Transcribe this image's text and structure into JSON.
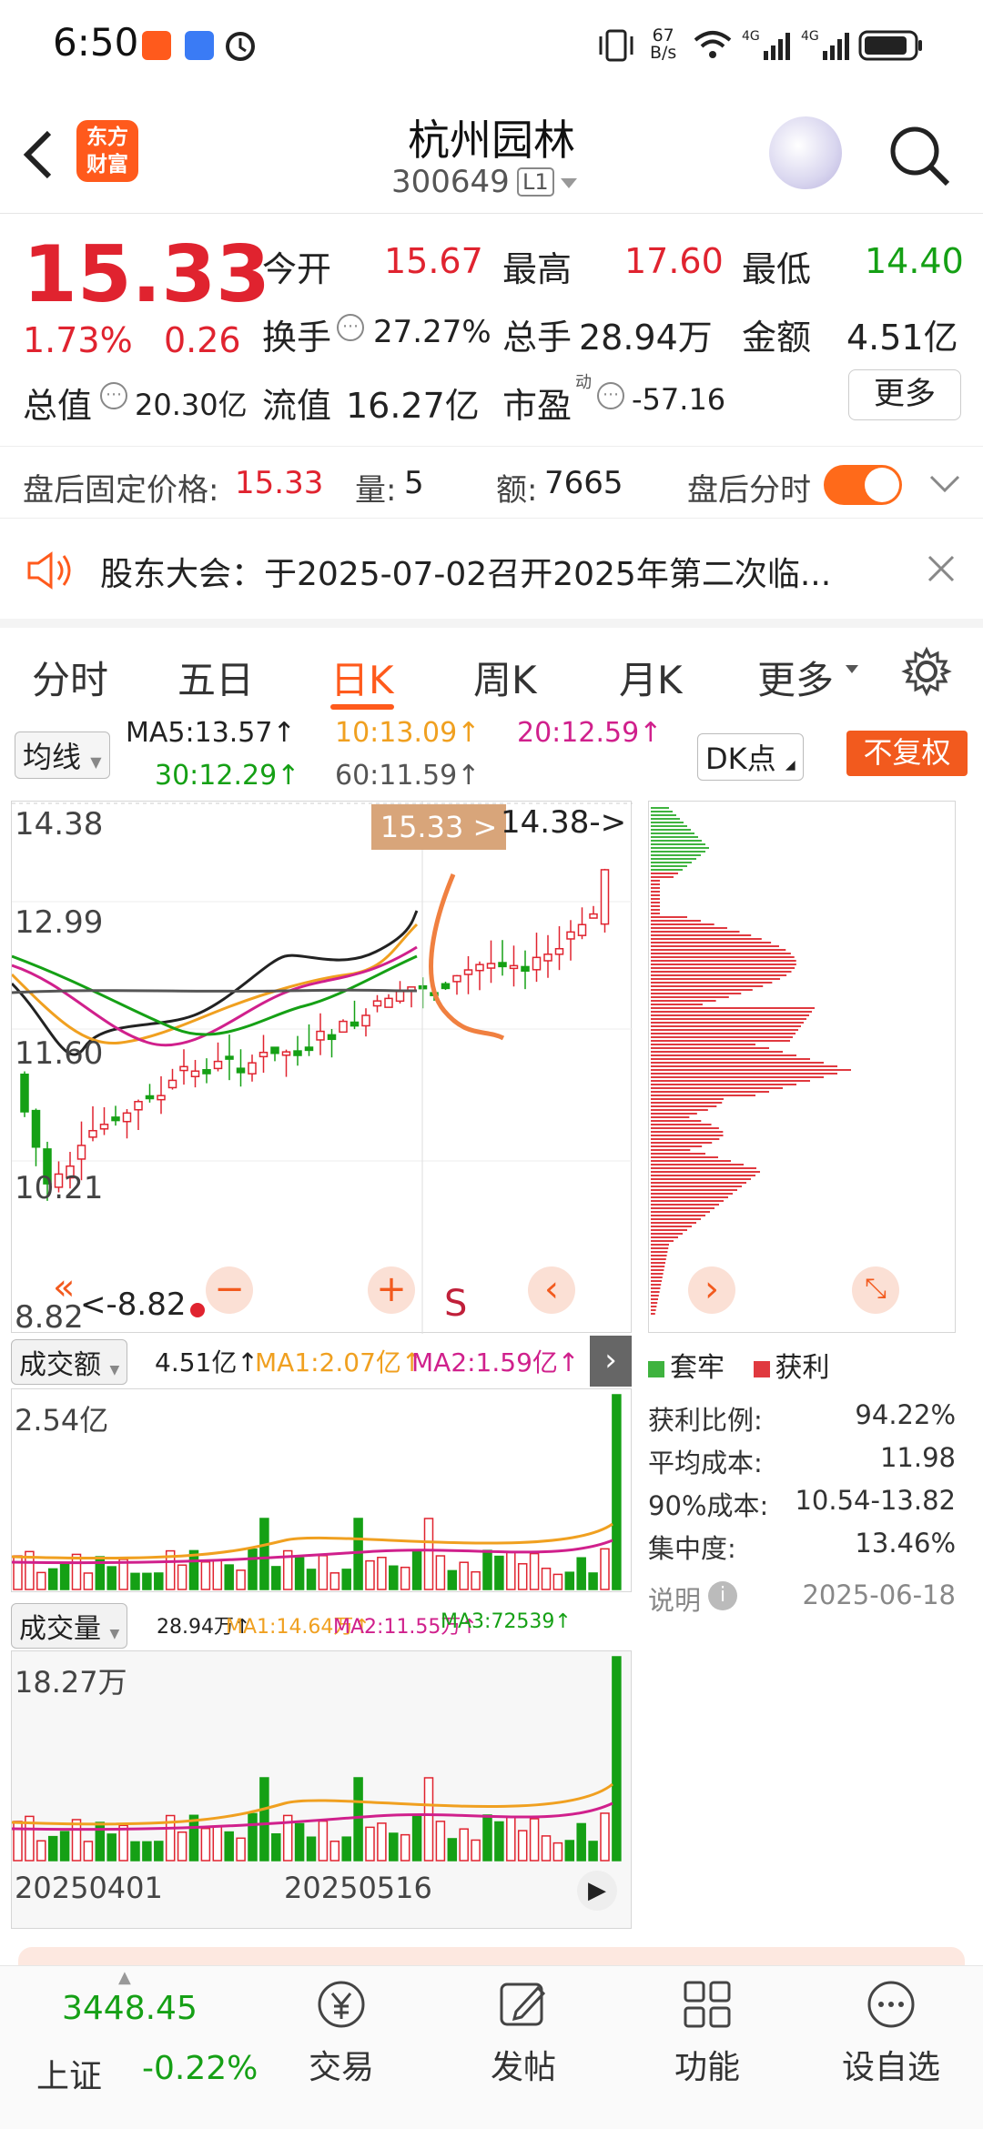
{
  "status": {
    "time": "6:50",
    "net_speed": "67\nB/s"
  },
  "header": {
    "logo_text": "东方\n财富",
    "title": "杭州园林",
    "code": "300649",
    "level": "L1"
  },
  "quote": {
    "price": "15.33",
    "pct": "1.73%",
    "chg": "0.26",
    "open_label": "今开",
    "open": "15.67",
    "high_label": "最高",
    "high": "17.60",
    "low_label": "最低",
    "low": "14.40",
    "turnover_label": "换手",
    "turnover": "27.27%",
    "volume_label": "总手",
    "volume": "28.94万",
    "amount_label": "金额",
    "amount": "4.51亿",
    "mktcap_label": "总值",
    "mktcap": "20.30亿",
    "float_label": "流值",
    "float": "16.27亿",
    "pe_label": "市盈",
    "pe_sup": "动",
    "pe": "-57.16",
    "more_label": "更多"
  },
  "after": {
    "price_label": "盘后固定价格:",
    "price": "15.33",
    "qty_label": "量:",
    "qty": "5",
    "amt_label": "额:",
    "amt": "7665",
    "fenshi_label": "盘后分时"
  },
  "notice": {
    "text": "股东大会：于2025-07-02召开2025年第二次临..."
  },
  "tabs": [
    "分时",
    "五日",
    "日K",
    "周K",
    "月K",
    "更多"
  ],
  "ma_row": {
    "avg_label": "均线",
    "ma5": "MA5:13.57↑",
    "ma10": "10:13.09↑",
    "ma20": "20:12.59↑",
    "ma30": "30:12.29↑",
    "ma60": "60:11.59↑",
    "dk_label": "DK点",
    "fq_label": "不复权"
  },
  "kchart": {
    "y_labels": [
      "14.38",
      "12.99",
      "11.60",
      "10.21",
      "8.82"
    ],
    "price_tag": "15.33 >",
    "high_tag": "14.38->",
    "low_tag": "<-8.82",
    "s_mark": "S",
    "dates": [
      "20250401",
      "20250516"
    ]
  },
  "amount_bar": {
    "label": "成交额",
    "value": "4.51亿↑",
    "ma1": "MA1:2.07亿↑",
    "ma2": "MA2:1.59亿↑",
    "max": "2.54亿"
  },
  "volume_bar": {
    "label": "成交量",
    "value": "28.94万↑",
    "ma1": "MA1:14.64万↑",
    "ma2": "MA2:11.55万↑",
    "ma3": "MA3:72539↑",
    "max": "18.27万"
  },
  "chips": {
    "legend_trapped": "套牢",
    "legend_profit": "获利",
    "profit_ratio_label": "获利比例:",
    "profit_ratio": "94.22%",
    "avg_cost_label": "平均成本:",
    "avg_cost": "11.98",
    "cost90_label": "90%成本:",
    "cost90": "10.54-13.82",
    "concentration_label": "集中度:",
    "concentration": "13.46%",
    "note_label": "说明",
    "date": "2025-06-18"
  },
  "bottom": {
    "index_value": "3448.45",
    "index_name": "上证",
    "index_chg": "-0.22%",
    "items": [
      "交易",
      "发帖",
      "功能",
      "设自选"
    ]
  },
  "colors": {
    "up": "#e0232f",
    "down": "#15a015",
    "accent": "#ff5a1c"
  }
}
